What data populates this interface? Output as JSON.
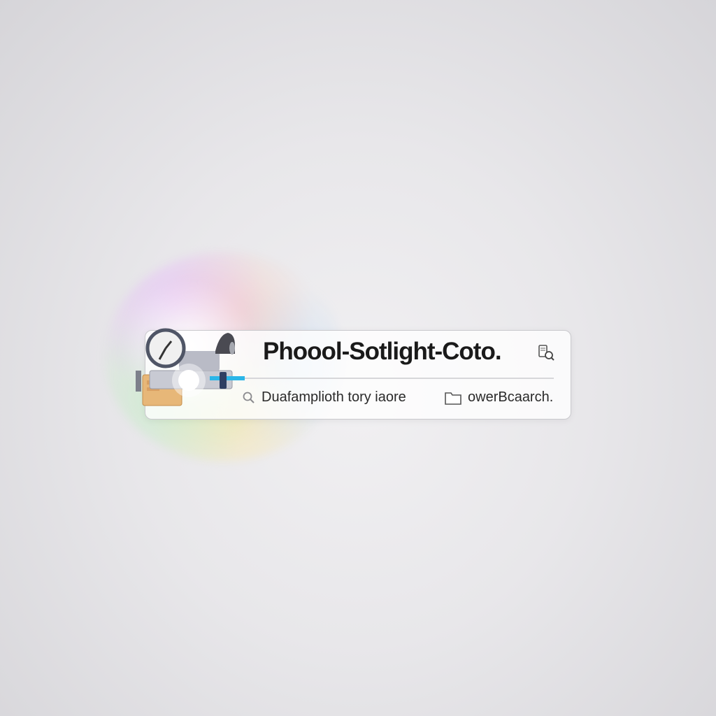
{
  "spotlight": {
    "title": "Phoool-Sotlight-Coto.",
    "results": [
      {
        "icon": "search-icon",
        "label": "Duafamplioth tory iaore"
      },
      {
        "icon": "folder-icon",
        "label": "owerBcaarch."
      }
    ],
    "right_icon": "app-preview-icon",
    "illustration_icon": "search-tools-illustration-icon"
  },
  "colors": {
    "panel_border": "#c9c9cd",
    "accent_cyan": "#2bb6e8",
    "text": "#1a1a1a"
  }
}
